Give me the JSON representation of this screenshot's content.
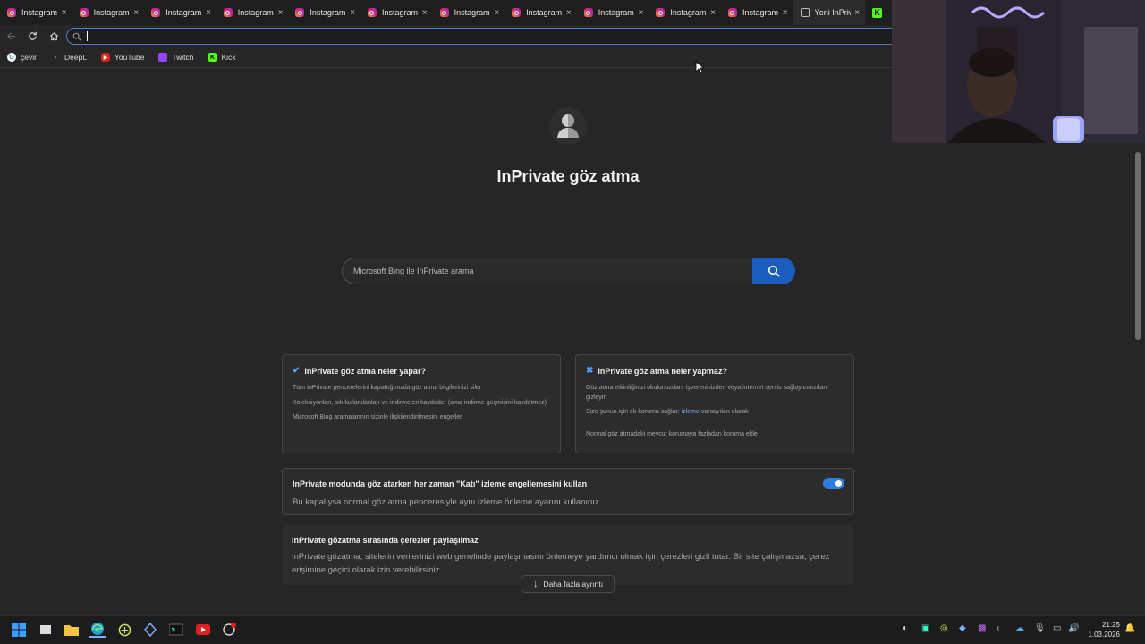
{
  "tabs": [
    {
      "label": "Instagram -",
      "icon": "instagram-icon"
    },
    {
      "label": "Instagram",
      "icon": "instagram-icon"
    },
    {
      "label": "Instagram",
      "icon": "instagram-icon"
    },
    {
      "label": "Instagram",
      "icon": "instagram-icon"
    },
    {
      "label": "Instagram",
      "icon": "instagram-icon"
    },
    {
      "label": "Instagram",
      "icon": "instagram-icon"
    },
    {
      "label": "Instagram",
      "icon": "instagram-icon"
    },
    {
      "label": "Instagram",
      "icon": "instagram-icon"
    },
    {
      "label": "Instagram",
      "icon": "instagram-icon"
    },
    {
      "label": "Instagram",
      "icon": "instagram-icon"
    },
    {
      "label": "Instagram",
      "icon": "instagram-icon"
    },
    {
      "label": "Yeni InPrivat",
      "icon": "inprivate-icon"
    }
  ],
  "tab_close_glyph": "×",
  "address_bar": {
    "value": ""
  },
  "favorites": [
    {
      "label": "çevir",
      "icon": "google-icon"
    },
    {
      "label": "DeepL",
      "icon": "deepl-icon"
    },
    {
      "label": "YouTube",
      "icon": "youtube-icon"
    },
    {
      "label": "Twitch",
      "icon": "twitch-icon"
    },
    {
      "label": "Kick",
      "icon": "kick-icon"
    }
  ],
  "page": {
    "title": "InPrivate göz atma",
    "search_placeholder": "Microsoft Bing ile InPrivate arama",
    "does": {
      "title": "InPrivate göz atma neler yapar?",
      "items": [
        "Tüm InPrivate pencerelerini kapattığınızda göz atma bilgilerinizi siler",
        "Koleksiyonları, sık kullanılanları ve indirmeleri kaydeder (ama indirme geçmişini kaydetmez)",
        "Microsoft Bing aramalarının sizinle ilişkilendirilmesini engeller"
      ]
    },
    "doesnt": {
      "title": "InPrivate göz atma neler yapmaz?",
      "item1": "Göz atma etkinliğinizi okulunuzdan, işvereninizden veya internet servis sağlayıcınızdan gizleyin",
      "item2_prefix": "Size şunun için ek koruma sağlar:",
      "item2_link": "izleme",
      "item2_suffix": "varsayılan olarak",
      "item3": "Normal göz atmadaki mevcut korumaya fazladan koruma ekle"
    },
    "strict": {
      "title": "InPrivate modunda göz atarken her zaman \"Katı\" izleme engellemesini kullan",
      "subtitle": "Bu kapalıysa normal göz atma penceresiyle aynı izleme önleme ayarını kullanınız",
      "enabled": true
    },
    "cookies": {
      "title": "InPrivate gözatma sırasında çerezler paylaşılmaz",
      "body": "InPrivate gözatma, sitelerin verilerinizi web genelinde paylaşmasını önlemeye yardımcı olmak için çerezleri gizli tutar. Bir site çalışmazsa, çerez erişimine geçici olarak izin verebilirsiniz."
    },
    "more_button": "Daha fazla ayrıntı"
  },
  "taskbar": {
    "time": "21:25",
    "date": "1.03.2026",
    "apps": [
      "start-icon",
      "task-view-icon",
      "file-explorer-icon",
      "edge-icon",
      "app-circle-icon",
      "app-diamond-icon",
      "terminal-icon",
      "youtube-icon",
      "app-notification-icon"
    ]
  },
  "colors": {
    "accent": "#1b5dbf",
    "toggle_on": "#2f7de1",
    "page_bg": "#262626"
  }
}
